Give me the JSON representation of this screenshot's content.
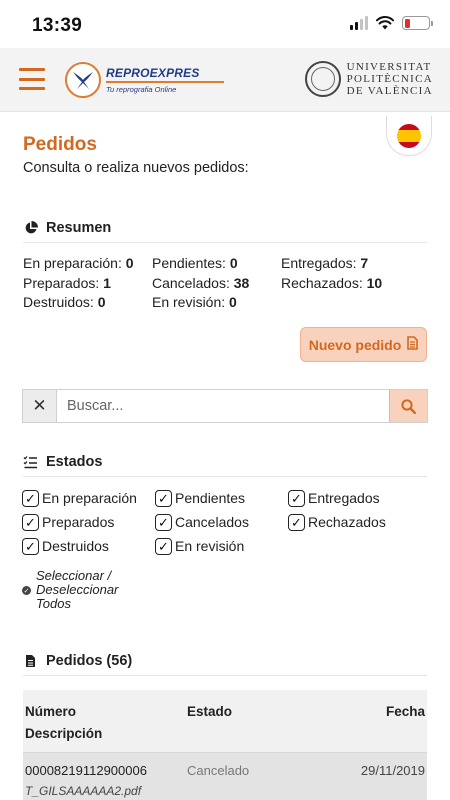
{
  "status_bar": {
    "time": "13:39",
    "battery_color": "#e0312c"
  },
  "header": {
    "menu_icon": "hamburger-icon",
    "brand": {
      "name": "REPROEXPRES",
      "tagline": "Tu reprografia Online",
      "accent": "#e07a2f",
      "primary": "#1f3c88"
    },
    "university": {
      "line1": "UNIVERSITAT",
      "line2": "POLITÈCNICA",
      "line3": "DE VALÈNCIA"
    }
  },
  "language": {
    "icon": "spain-flag-icon"
  },
  "page": {
    "title": "Pedidos",
    "subtitle": "Consulta o realiza nuevos pedidos:",
    "accent": "#d2691e"
  },
  "summary": {
    "heading": "Resumen",
    "icon": "pie-chart-icon",
    "rows": [
      [
        {
          "label": "En preparación:",
          "value": "0"
        },
        {
          "label": "Pendientes:",
          "value": "0"
        },
        {
          "label": "Entregados:",
          "value": "7"
        }
      ],
      [
        {
          "label": "Preparados:",
          "value": "1"
        },
        {
          "label": "Cancelados:",
          "value": "38"
        },
        {
          "label": "Rechazados:",
          "value": "10"
        }
      ],
      [
        {
          "label": "Destruidos:",
          "value": "0"
        },
        {
          "label": "En revisión:",
          "value": "0"
        },
        null
      ]
    ]
  },
  "new_order": {
    "label": "Nuevo pedido",
    "icon": "document-icon"
  },
  "search": {
    "placeholder": "Buscar...",
    "value": "",
    "clear_icon": "close-icon",
    "search_icon": "search-icon"
  },
  "states": {
    "heading": "Estados",
    "icon": "checklist-icon",
    "items": [
      {
        "label": "En preparación",
        "checked": true
      },
      {
        "label": "Pendientes",
        "checked": true
      },
      {
        "label": "Entregados",
        "checked": true
      },
      {
        "label": "Preparados",
        "checked": true
      },
      {
        "label": "Cancelados",
        "checked": true
      },
      {
        "label": "Rechazados",
        "checked": true
      },
      {
        "label": "Destruidos",
        "checked": true
      },
      {
        "label": "En revisión",
        "checked": true
      }
    ],
    "select_all": {
      "line1": "Seleccionar /",
      "line2": "Deseleccionar",
      "line3": "Todos"
    }
  },
  "orders": {
    "heading": "Pedidos (56)",
    "icon": "file-icon",
    "columns": {
      "number": "Número",
      "state": "Estado",
      "date": "Fecha",
      "description": "Descripción"
    },
    "rows": [
      {
        "number": "00008219112900006",
        "state": "Cancelado",
        "date": "29/11/2019",
        "description": "T_GILSAAAAAA2.pdf"
      }
    ]
  }
}
